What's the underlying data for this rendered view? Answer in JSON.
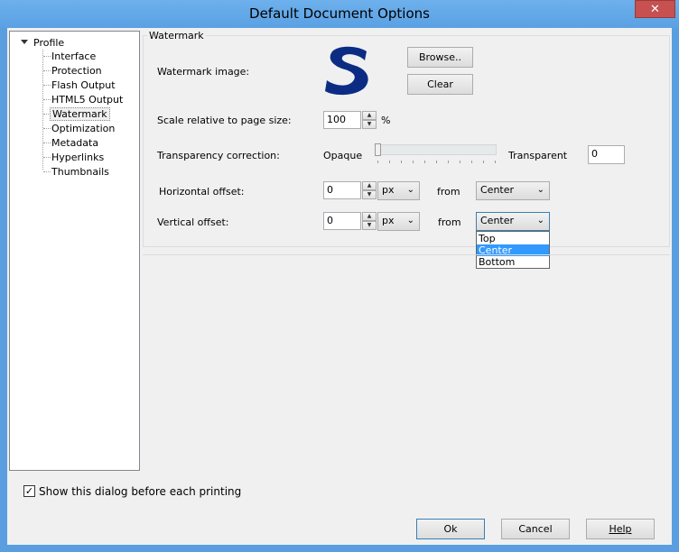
{
  "window": {
    "title": "Default Document Options",
    "close": "✕"
  },
  "tree": {
    "root": "Profile",
    "items": [
      "Interface",
      "Protection",
      "Flash Output",
      "HTML5 Output",
      "Watermark",
      "Optimization",
      "Metadata",
      "Hyperlinks",
      "Thumbnails"
    ],
    "selected": "Watermark"
  },
  "watermark": {
    "group_title": "Watermark",
    "image_label": "Watermark image:",
    "browse": "Browse..",
    "clear": "Clear",
    "scale_label": "Scale relative to page size:",
    "scale_value": "100",
    "scale_unit": "%",
    "transparency_label": "Transparency correction:",
    "opaque": "Opaque",
    "transparent": "Transparent",
    "transparency_value": "0",
    "transparency_level": 0,
    "h_label": "Horizontal offset:",
    "h_value": "0",
    "h_unit": "px",
    "h_from": "from",
    "h_anchor": "Center",
    "v_label": "Vertical offset:",
    "v_value": "0",
    "v_unit": "px",
    "v_from": "from",
    "v_anchor": "Center",
    "v_options": [
      "Top",
      "Center",
      "Bottom"
    ],
    "v_option_selected": "Center"
  },
  "footer": {
    "show_dialog": "Show this dialog before each printing",
    "show_dialog_checked": true,
    "ok": "Ok",
    "cancel": "Cancel",
    "help": "Help"
  },
  "colors": {
    "logo": "#0c2c84",
    "selection": "#3399ff",
    "close": "#c75050"
  }
}
